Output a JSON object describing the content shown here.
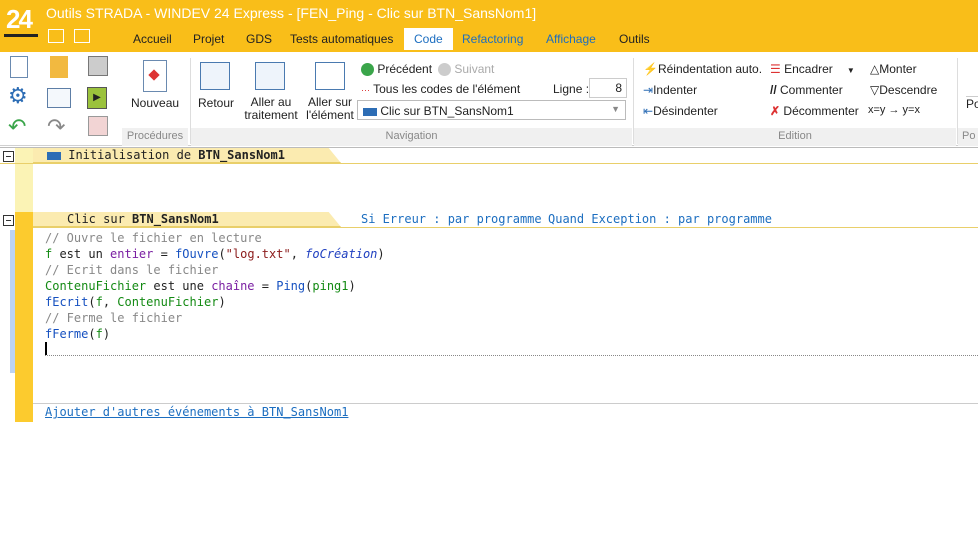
{
  "window": {
    "title": "Outils STRADA - WINDEV 24 Express - [FEN_Ping - Clic sur BTN_SansNom1]",
    "logo": "24"
  },
  "tabs": [
    {
      "label": "Accueil"
    },
    {
      "label": "Projet"
    },
    {
      "label": "GDS"
    },
    {
      "label": "Tests automatiques"
    },
    {
      "label": "Code",
      "active": true
    },
    {
      "label": "Refactoring"
    },
    {
      "label": "Affichage"
    },
    {
      "label": "Outils"
    }
  ],
  "ribbon": {
    "procedures": {
      "group": "Procédures",
      "nouveau": "Nouveau"
    },
    "navigation": {
      "group": "Navigation",
      "retour": "Retour",
      "aller_traitement": "Aller au traitement",
      "aller_element": "Aller sur l'élément",
      "precedent": "Précédent",
      "suivant": "Suivant",
      "tous_codes": "Tous les codes de l'élément",
      "ligne_label": "Ligne :",
      "ligne_value": "8",
      "combo_value": "Clic sur BTN_SansNom1"
    },
    "edition": {
      "group": "Edition",
      "reindent": "Réindentation auto.",
      "indenter": "Indenter",
      "desindenter": "Désindenter",
      "encadrer": "Encadrer",
      "commenter": "Commenter",
      "decommenter": "Décommenter",
      "monter": "Monter",
      "descendre": "Descendre",
      "swap": "x=y → y=x"
    },
    "partial": {
      "item": "Po",
      "group": "Po"
    }
  },
  "editor": {
    "init_header": {
      "prefix": "Initialisation de ",
      "name": "BTN_SansNom1"
    },
    "click_header": {
      "prefix": "Clic sur ",
      "name": "BTN_SansNom1",
      "error": "Si Erreur : par programme",
      "exception": "Quand Exception : par programme"
    },
    "lines": [
      [
        {
          "t": "// Ouvre le fichier en lecture",
          "c": "cm"
        }
      ],
      [
        {
          "t": "f",
          "c": "vr"
        },
        {
          "t": " est un "
        },
        {
          "t": "entier",
          "c": "kw"
        },
        {
          "t": " = "
        },
        {
          "t": "fOuvre",
          "c": "fn"
        },
        {
          "t": "("
        },
        {
          "t": "\"log.txt\"",
          "c": "st"
        },
        {
          "t": ", "
        },
        {
          "t": "foCréation",
          "c": "it"
        },
        {
          "t": ")"
        }
      ],
      [
        {
          "t": "// Ecrit dans le fichier",
          "c": "cm"
        }
      ],
      [
        {
          "t": "ContenuFichier",
          "c": "vr"
        },
        {
          "t": " est une "
        },
        {
          "t": "chaîne",
          "c": "kw"
        },
        {
          "t": " = "
        },
        {
          "t": "Ping",
          "c": "fn"
        },
        {
          "t": "("
        },
        {
          "t": "ping1",
          "c": "vr"
        },
        {
          "t": ")"
        }
      ],
      [
        {
          "t": "fEcrit",
          "c": "fn"
        },
        {
          "t": "("
        },
        {
          "t": "f",
          "c": "vr"
        },
        {
          "t": ", "
        },
        {
          "t": "ContenuFichier",
          "c": "vr"
        },
        {
          "t": ")"
        }
      ],
      [
        {
          "t": "// Ferme le fichier",
          "c": "cm"
        }
      ],
      [
        {
          "t": "fFerme",
          "c": "fn"
        },
        {
          "t": "("
        },
        {
          "t": "f",
          "c": "vr"
        },
        {
          "t": ")"
        }
      ],
      [
        {
          "t": ""
        }
      ]
    ],
    "add_events_link": "Ajouter d'autres événements à BTN_SansNom1"
  },
  "colors": {
    "accent": "#F9BE19",
    "link": "#1c6ec0"
  }
}
